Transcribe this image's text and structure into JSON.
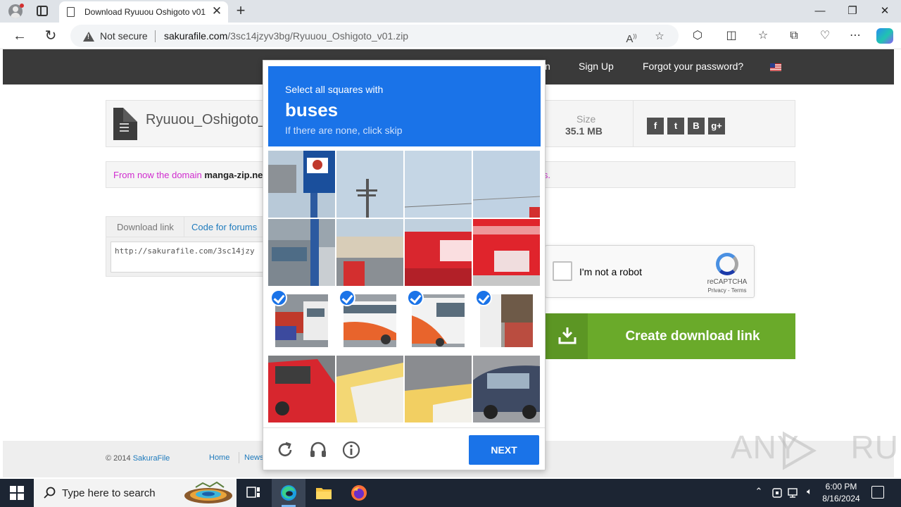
{
  "browser": {
    "tab_title": "Download Ryuuou Oshigoto v01",
    "security_label": "Not secure",
    "url_domain": "sakurafile.com",
    "url_path": "/3sc14jzyv3bg/Ryuuou_Oshigoto_v01.zip"
  },
  "header": {
    "links": [
      "n",
      "Sign Up",
      "Forgot your password?"
    ]
  },
  "file": {
    "name": "Ryuuou_Oshigoto_v",
    "size_label": "Size",
    "size_value": "35.1 MB",
    "social": [
      "f",
      "t",
      "B",
      "g+"
    ]
  },
  "notice": {
    "prefix": "From now the domain ",
    "domain": "manga-zip.net",
    "suffix": "rks."
  },
  "code": {
    "tabs": [
      "Download link",
      "Code for forums"
    ],
    "link": "http://sakurafile.com/3sc14jzy"
  },
  "recaptcha": {
    "label": "I'm not a robot",
    "brand": "reCAPTCHA",
    "terms": "Privacy - Terms"
  },
  "download": {
    "label": "Create download link"
  },
  "footer": {
    "copyright": "© 2014 ",
    "brand": "SakuraFile",
    "links": [
      "Home",
      "News"
    ]
  },
  "challenge": {
    "instruction": "Select all squares with",
    "target": "buses",
    "hint": "If there are none, click skip",
    "selected_tiles": [
      8,
      9,
      10,
      11
    ],
    "next_label": "NEXT"
  },
  "watermark": "ANY RUN",
  "taskbar": {
    "search_placeholder": "Type here to search",
    "time": "6:00 PM",
    "date": "8/16/2024"
  },
  "colors": {
    "challenge_blue": "#1a73e8",
    "download_green": "#6aaa2a",
    "site_header": "#3a3a3a",
    "notice_magenta": "#d02ccf"
  }
}
